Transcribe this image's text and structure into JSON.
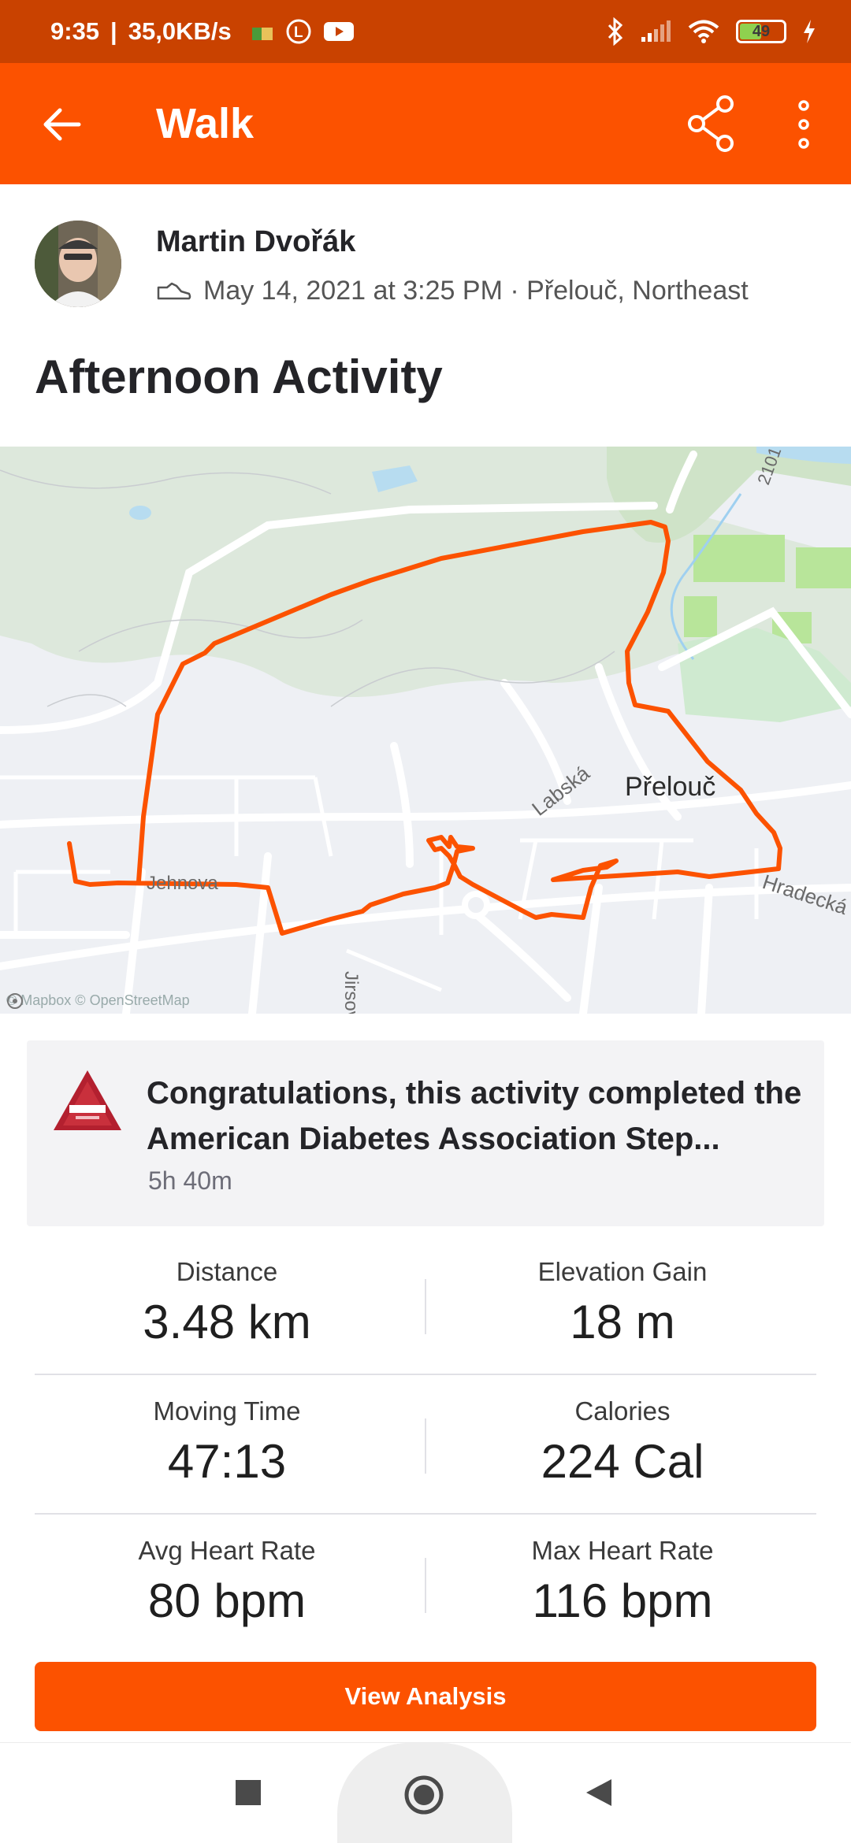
{
  "status_bar": {
    "time": "9:35",
    "speed": "35,0KB/s",
    "battery": "49"
  },
  "app_bar": {
    "title": "Walk",
    "icons": [
      "back-arrow-icon",
      "share-icon",
      "more-vert-icon"
    ]
  },
  "header": {
    "athlete_name": "Martin Dvořák",
    "meta": "May 14, 2021 at 3:25 PM · Přelouč, Northeast",
    "activity_title": "Afternoon Activity"
  },
  "map": {
    "place_label": "Přelouč",
    "street_labels": [
      "Labská",
      "Hradecká",
      "Jehnova",
      "Jirsova",
      "2101"
    ],
    "attribution": "© Mapbox © OpenStreetMap",
    "route_color": "#fc5200"
  },
  "challenge": {
    "text": "Congratulations, this activity completed the American Diabetes Association Step...",
    "time": "5h 40m"
  },
  "stats": [
    {
      "label": "Distance",
      "value": "3.48 km"
    },
    {
      "label": "Elevation Gain",
      "value": "18 m"
    },
    {
      "label": "Moving Time",
      "value": "47:13"
    },
    {
      "label": "Calories",
      "value": "224 Cal"
    },
    {
      "label": "Avg Heart Rate",
      "value": "80 bpm"
    },
    {
      "label": "Max Heart Rate",
      "value": "116 bpm"
    }
  ],
  "cta": {
    "label": "View Analysis"
  },
  "colors": {
    "brand": "#fc5200",
    "status_bar": "#c94200"
  }
}
